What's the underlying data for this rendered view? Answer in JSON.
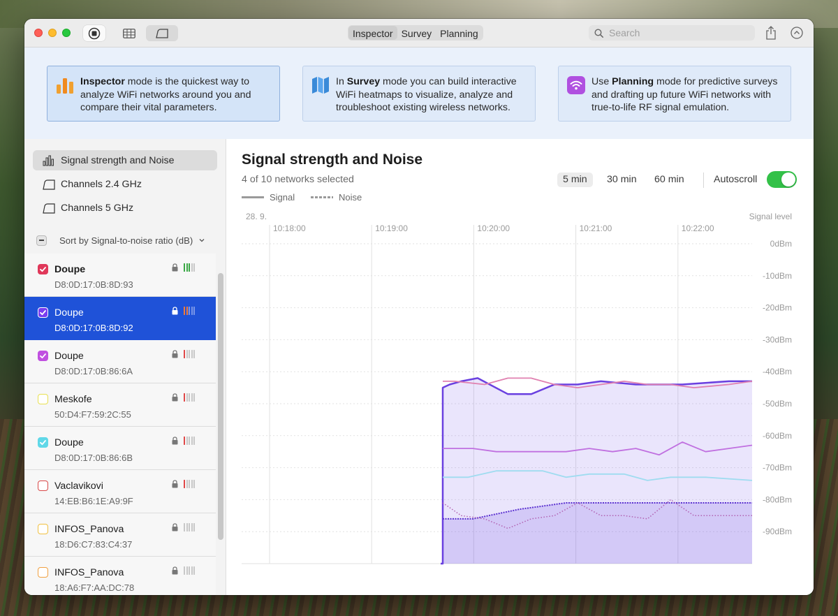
{
  "toolbar": {
    "modes": [
      "Inspector",
      "Survey",
      "Planning"
    ],
    "active_mode": "Inspector",
    "search_placeholder": "Search"
  },
  "banner": {
    "cards": [
      {
        "pre": "",
        "bold": "Inspector",
        "post": " mode is the quickest way to analyze WiFi networks around you and compare their vital parameters."
      },
      {
        "pre": "In ",
        "bold": "Survey",
        "post": " mode you can build interactive WiFi heatmaps to visualize, analyze and troubleshoot existing wireless networks."
      },
      {
        "pre": "Use ",
        "bold": "Planning",
        "post": " mode for predictive surveys and drafting up future WiFi networks with true-to-life RF signal emulation."
      }
    ]
  },
  "sidebar": {
    "nav": [
      {
        "label": "Signal strength and Noise",
        "icon": "bar-chart-icon",
        "active": true
      },
      {
        "label": "Channels 2.4 GHz",
        "icon": "channels-icon",
        "active": false
      },
      {
        "label": "Channels 5 GHz",
        "icon": "channels-icon",
        "active": false
      }
    ],
    "sort_label": "Sort by Signal-to-noise ratio (dB)",
    "networks": [
      {
        "name": "Doupe",
        "mac": "D8:0D:17:0B:8D:93",
        "color": "#e0385a",
        "checked": true,
        "bold": true,
        "selected": false,
        "bars_on": 3,
        "bar_color": "#3aa845"
      },
      {
        "name": "Doupe",
        "mac": "D8:0D:17:0B:8D:92",
        "color": "#7a3df0",
        "checked": true,
        "bold": false,
        "selected": true,
        "bars_on": 2,
        "bar_color": "#f07a3a"
      },
      {
        "name": "Doupe",
        "mac": "D8:0D:17:0B:86:6A",
        "color": "#c050e0",
        "checked": true,
        "bold": false,
        "selected": false,
        "bars_on": 1,
        "bar_color": "#e04848"
      },
      {
        "name": "Meskofe",
        "mac": "50:D4:F7:59:2C:55",
        "color": "#e8e050",
        "checked": false,
        "bold": false,
        "selected": false,
        "bars_on": 1,
        "bar_color": "#e04848"
      },
      {
        "name": "Doupe",
        "mac": "D8:0D:17:0B:86:6B",
        "color": "#60d8e8",
        "checked": true,
        "bold": false,
        "selected": false,
        "bars_on": 1,
        "bar_color": "#e04848"
      },
      {
        "name": "Vaclavikovi",
        "mac": "14:EB:B6:1E:A9:9F",
        "color": "#d84848",
        "checked": false,
        "bold": false,
        "selected": false,
        "bars_on": 1,
        "bar_color": "#e04848"
      },
      {
        "name": "INFOS_Panova",
        "mac": "18:D6:C7:83:C4:37",
        "color": "#f0c040",
        "checked": false,
        "bold": false,
        "selected": false,
        "bars_on": 0,
        "bar_color": "#bbbbbb"
      },
      {
        "name": "INFOS_Panova",
        "mac": "18:A6:F7:AA:DC:78",
        "color": "#f0a040",
        "checked": false,
        "bold": false,
        "selected": false,
        "bars_on": 0,
        "bar_color": "#bbbbbb"
      }
    ]
  },
  "main": {
    "title": "Signal strength and Noise",
    "subtitle": "4 of 10 networks selected",
    "time_ranges": [
      "5 min",
      "30 min",
      "60 min"
    ],
    "active_range": "5 min",
    "autoscroll_label": "Autoscroll",
    "autoscroll_on": true,
    "legend": {
      "signal": "Signal",
      "noise": "Noise"
    }
  },
  "chart_data": {
    "type": "line",
    "date_label": "28. 9.",
    "y_axis_title": "Signal level",
    "x_ticks": [
      "10:18:00",
      "10:19:00",
      "10:20:00",
      "10:21:00",
      "10:22:00"
    ],
    "y_ticks": [
      "0dBm",
      "-10dBm",
      "-20dBm",
      "-30dBm",
      "-40dBm",
      "-50dBm",
      "-60dBm",
      "-70dBm",
      "-80dBm",
      "-90dBm"
    ],
    "ylim": [
      -100,
      0
    ],
    "x_seconds_per_tick": 60,
    "grid": true,
    "legend": "top-left",
    "series": [
      {
        "kind": "signal",
        "color": "#6a40e0",
        "fill": true,
        "width": 2.5,
        "points": [
          [
            10.07,
            -45
          ],
          [
            10.1,
            -44
          ],
          [
            10.15,
            -43
          ],
          [
            10.22,
            -42
          ],
          [
            10.35,
            -47
          ],
          [
            10.45,
            -47
          ],
          [
            10.55,
            -44
          ],
          [
            10.65,
            -44
          ],
          [
            10.75,
            -43
          ],
          [
            10.9,
            -44
          ],
          [
            11.1,
            -44
          ],
          [
            11.3,
            -43
          ],
          [
            11.4,
            -43
          ]
        ]
      },
      {
        "kind": "signal",
        "color": "#e080b0",
        "fill": false,
        "width": 1.8,
        "points": [
          [
            10.07,
            -43
          ],
          [
            10.12,
            -43
          ],
          [
            10.25,
            -44
          ],
          [
            10.35,
            -42
          ],
          [
            10.45,
            -42
          ],
          [
            10.55,
            -44
          ],
          [
            10.65,
            -45
          ],
          [
            10.75,
            -44
          ],
          [
            10.85,
            -43
          ],
          [
            10.95,
            -44
          ],
          [
            11.05,
            -44
          ],
          [
            11.15,
            -45
          ],
          [
            11.3,
            -44
          ],
          [
            11.4,
            -43
          ]
        ]
      },
      {
        "kind": "signal",
        "color": "#c070e0",
        "fill": false,
        "width": 1.8,
        "points": [
          [
            10.07,
            -64
          ],
          [
            10.2,
            -64
          ],
          [
            10.3,
            -65
          ],
          [
            10.5,
            -65
          ],
          [
            10.6,
            -65
          ],
          [
            10.7,
            -64
          ],
          [
            10.8,
            -65
          ],
          [
            10.9,
            -64
          ],
          [
            11.0,
            -66
          ],
          [
            11.1,
            -62
          ],
          [
            11.2,
            -65
          ],
          [
            11.3,
            -64
          ],
          [
            11.4,
            -63
          ]
        ]
      },
      {
        "kind": "signal",
        "color": "#9fdcf0",
        "fill": false,
        "width": 1.8,
        "points": [
          [
            10.07,
            -73
          ],
          [
            10.18,
            -73
          ],
          [
            10.3,
            -71
          ],
          [
            10.5,
            -71
          ],
          [
            10.6,
            -73
          ],
          [
            10.7,
            -72
          ],
          [
            10.85,
            -72
          ],
          [
            10.95,
            -74
          ],
          [
            11.05,
            -73
          ],
          [
            11.2,
            -73
          ],
          [
            11.4,
            -74
          ]
        ]
      },
      {
        "kind": "noise",
        "color": "#5a30d0",
        "fill": true,
        "width": 2,
        "points": [
          [
            10.07,
            -86
          ],
          [
            10.2,
            -86
          ],
          [
            10.4,
            -83
          ],
          [
            10.5,
            -82
          ],
          [
            10.6,
            -81
          ],
          [
            10.8,
            -81
          ],
          [
            11.0,
            -81
          ],
          [
            11.2,
            -81
          ],
          [
            11.4,
            -81
          ]
        ]
      },
      {
        "kind": "noise",
        "color": "#b060b0",
        "fill": false,
        "width": 1.5,
        "points": [
          [
            10.07,
            -81
          ],
          [
            10.15,
            -85
          ],
          [
            10.25,
            -86
          ],
          [
            10.35,
            -89
          ],
          [
            10.45,
            -86
          ],
          [
            10.55,
            -85
          ],
          [
            10.65,
            -81
          ],
          [
            10.75,
            -85
          ],
          [
            10.85,
            -85
          ],
          [
            10.95,
            -86
          ],
          [
            11.05,
            -80
          ],
          [
            11.15,
            -85
          ],
          [
            11.3,
            -85
          ],
          [
            11.4,
            -85
          ]
        ]
      }
    ]
  }
}
